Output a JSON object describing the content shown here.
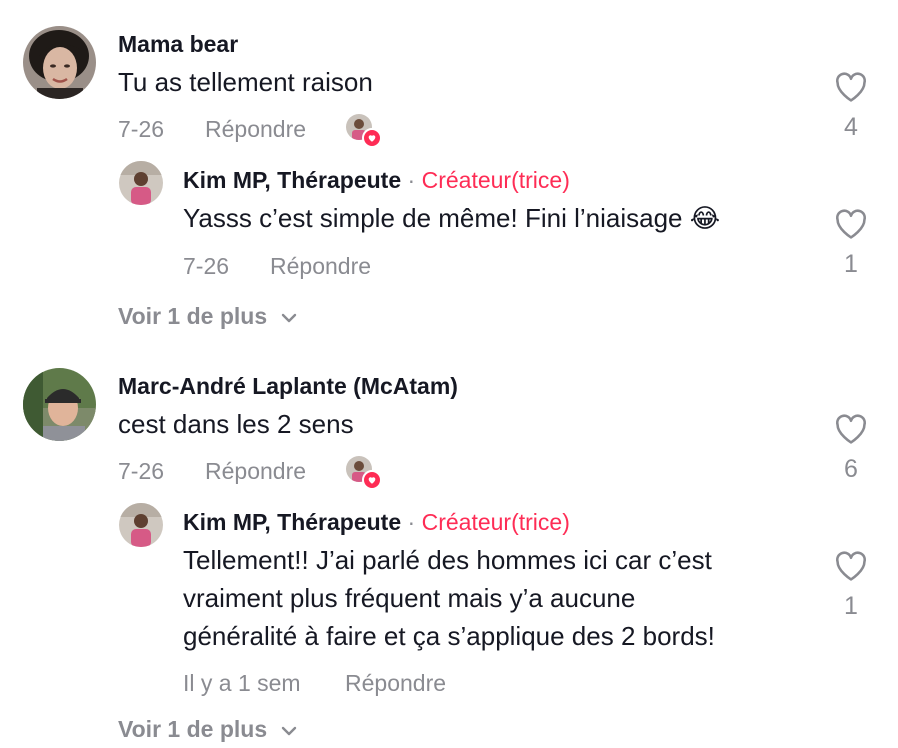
{
  "comments": [
    {
      "author": "Mama bear",
      "text": "Tu as tellement raison",
      "date": "7-26",
      "reply_label": "Répondre",
      "likes": "4",
      "reply": {
        "author": "Kim MP, Thérapeute",
        "separator": "·",
        "badge": "Créateur(trice)",
        "lines": [
          "Yasss c’est simple de même! Fini l’niaisage 😂"
        ],
        "date": "7-26",
        "reply_label": "Répondre",
        "likes": "1"
      },
      "more_label": "Voir 1 de plus"
    },
    {
      "author": "Marc-André Laplante (McAtam)",
      "text": "cest dans les 2 sens",
      "date": "7-26",
      "reply_label": "Répondre",
      "likes": "6",
      "reply": {
        "author": "Kim MP, Thérapeute",
        "separator": "·",
        "badge": "Créateur(trice)",
        "lines": [
          "Tellement!! J’ai parlé des hommes ici car c’est",
          "vraiment plus fréquent mais y’a aucune",
          "généralité à faire et ça s’applique des 2 bords!"
        ],
        "date": "Il y a 1 sem",
        "reply_label": "Répondre",
        "likes": "1"
      },
      "more_label": "Voir 1 de plus"
    }
  ],
  "icons": {
    "like": "heart-outline-icon",
    "creator_liked": "creator-liked-heart-icon",
    "expand": "chevron-down-icon"
  },
  "colors": {
    "creator_badge": "#fe2c55",
    "secondary_text": "#8a8b91",
    "primary_text": "#161823"
  }
}
